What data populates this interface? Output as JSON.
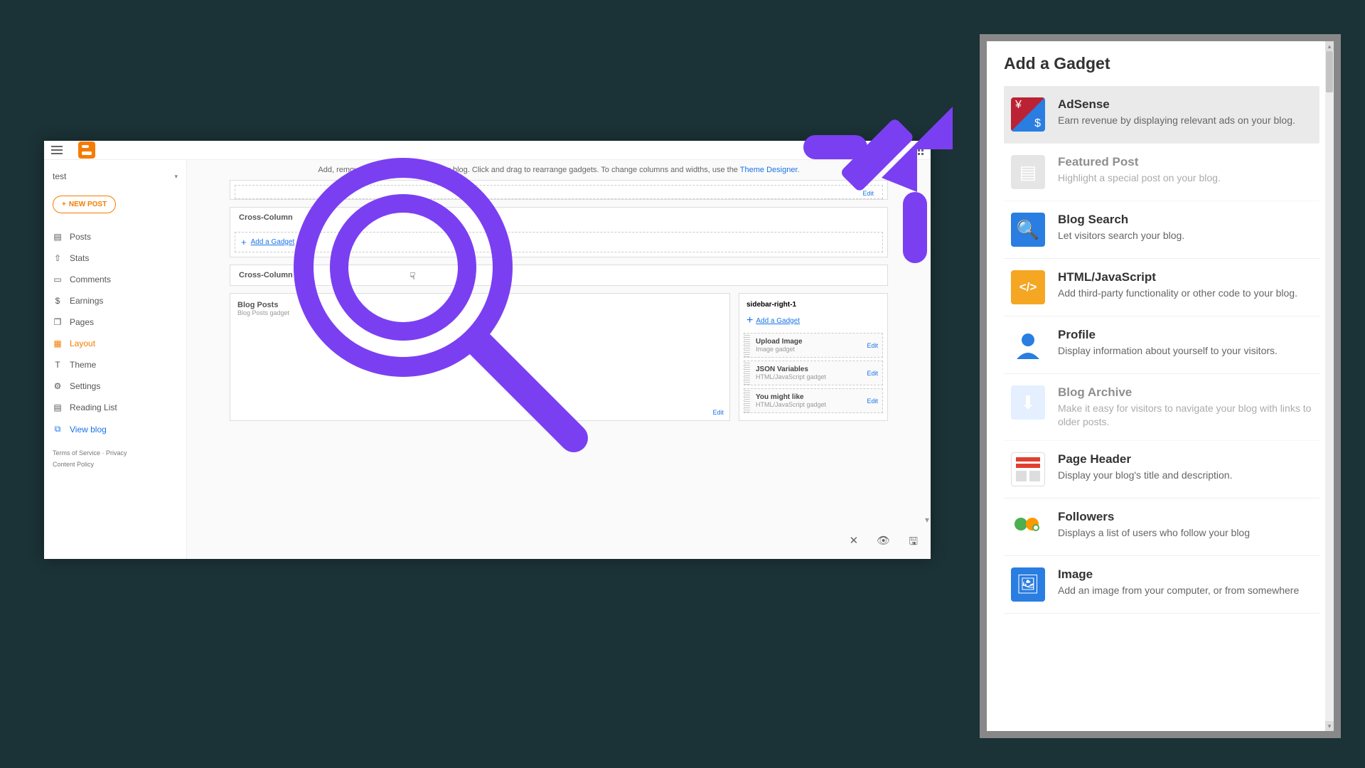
{
  "blogger": {
    "blog_name": "test",
    "new_post": "NEW POST",
    "nav": {
      "posts": "Posts",
      "stats": "Stats",
      "comments": "Comments",
      "earnings": "Earnings",
      "pages": "Pages",
      "layout": "Layout",
      "theme": "Theme",
      "settings": "Settings",
      "reading_list": "Reading List",
      "view_blog": "View blog"
    },
    "footer": {
      "terms": "Terms of Service",
      "privacy": "Privacy",
      "content_policy": "Content Policy"
    },
    "instruction_prefix": "Add, remove and edit gadgets on your blog. Click and drag to rearrange gadgets. To change columns and widths, use the ",
    "instruction_link": "Theme Designer",
    "layout": {
      "cross_column": "Cross-Column",
      "cross_column2": "Cross-Column 2",
      "add_gadget": "Add a Gadget",
      "edit": "Edit",
      "blog_posts": "Blog Posts",
      "blog_posts_sub": "Blog Posts gadget",
      "sidebar_right_title": "sidebar-right-1",
      "gadgets": [
        {
          "title": "Upload Image",
          "sub": "Image gadget"
        },
        {
          "title": "JSON Variables",
          "sub": "HTML/JavaScript gadget"
        },
        {
          "title": "You might like",
          "sub": "HTML/JavaScript gadget"
        }
      ]
    }
  },
  "dialog": {
    "title": "Add a Gadget",
    "items": [
      {
        "key": "adsense",
        "title": "AdSense",
        "desc": "Earn revenue by displaying relevant ads on your blog.",
        "icon": "adsense-icon",
        "state": "selected"
      },
      {
        "key": "featured",
        "title": "Featured Post",
        "desc": "Highlight a special post on your blog.",
        "icon": "featured-icon",
        "state": "disabled"
      },
      {
        "key": "search",
        "title": "Blog Search",
        "desc": "Let visitors search your blog.",
        "icon": "search-icon",
        "state": ""
      },
      {
        "key": "html",
        "title": "HTML/JavaScript",
        "desc": "Add third-party functionality or other code to your blog.",
        "icon": "html-icon",
        "state": ""
      },
      {
        "key": "profile",
        "title": "Profile",
        "desc": "Display information about yourself to your visitors.",
        "icon": "profile-icon",
        "state": ""
      },
      {
        "key": "archive",
        "title": "Blog Archive",
        "desc": "Make it easy for visitors to navigate your blog with links to older posts.",
        "icon": "archive-icon",
        "state": "disabled"
      },
      {
        "key": "header",
        "title": "Page Header",
        "desc": "Display your blog's title and description.",
        "icon": "header-icon",
        "state": ""
      },
      {
        "key": "followers",
        "title": "Followers",
        "desc": "Displays a list of users who follow your blog",
        "icon": "followers-icon",
        "state": ""
      },
      {
        "key": "image",
        "title": "Image",
        "desc": "Add an image from your computer, or from somewhere",
        "icon": "image-icon",
        "state": ""
      }
    ]
  }
}
